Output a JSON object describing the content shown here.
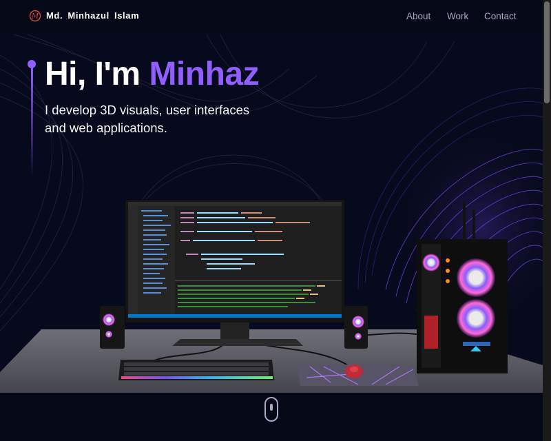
{
  "brand": {
    "name": "Md. Minhazul Islam",
    "logo_icon": "m-logo-icon"
  },
  "nav": {
    "items": [
      {
        "label": "About"
      },
      {
        "label": "Work"
      },
      {
        "label": "Contact"
      }
    ]
  },
  "hero": {
    "greeting": "Hi, I'm ",
    "name": "Minhaz",
    "subtitle": "I develop 3D visuals, user interfaces and web applications."
  },
  "scroll_indicator": {
    "icon": "mouse-scroll-icon"
  },
  "colors": {
    "background": "#050816",
    "accent": "#915eff",
    "secondary_text": "#aaa6c3"
  }
}
